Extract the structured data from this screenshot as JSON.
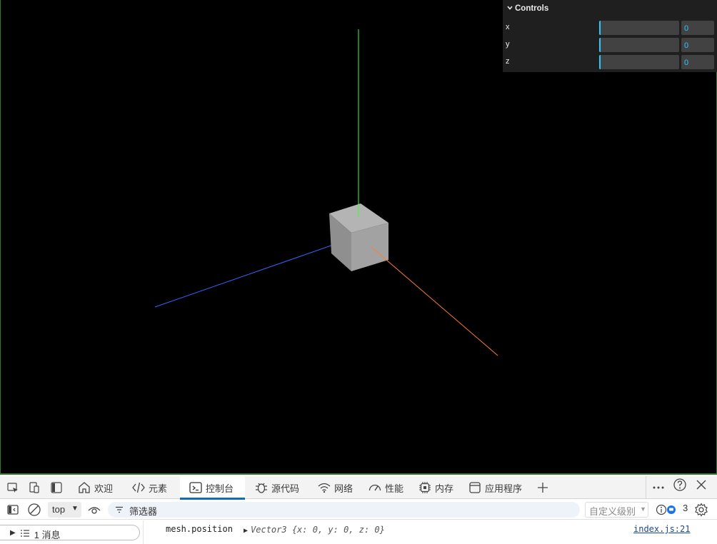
{
  "scene": {
    "background": "#000000",
    "axis_colors": {
      "x": "#ff7f2a",
      "y": "#44ff44",
      "z": "#3366ff"
    },
    "cube_color": "#a0a0a0"
  },
  "gui": {
    "title": "Controls",
    "rows": [
      {
        "label": "x",
        "value": "0",
        "level": 0
      },
      {
        "label": "y",
        "value": "0",
        "level": 0
      },
      {
        "label": "z",
        "value": "0",
        "level": 0
      }
    ],
    "accent": "#2cc9ff"
  },
  "devtools": {
    "tabs": [
      {
        "label": "欢迎",
        "icon": "home-icon"
      },
      {
        "label": "元素",
        "icon": "code-icon"
      },
      {
        "label": "控制台",
        "icon": "console-icon",
        "active": true
      },
      {
        "label": "源代码",
        "icon": "bug-icon"
      },
      {
        "label": "网络",
        "icon": "wifi-icon"
      },
      {
        "label": "性能",
        "icon": "gauge-icon"
      },
      {
        "label": "内存",
        "icon": "chip-icon"
      },
      {
        "label": "应用程序",
        "icon": "app-icon"
      }
    ],
    "filter": {
      "context": "top",
      "placeholder": "筛选器",
      "levels": "自定义级别",
      "issues_count": "3"
    },
    "sidebar": {
      "messages": "1 消息"
    },
    "log": {
      "expression": "mesh.position",
      "value": "Vector3 {x: 0, y: 0, z: 0}",
      "source": "index.js:21"
    },
    "accent": "#0f6cbd"
  }
}
